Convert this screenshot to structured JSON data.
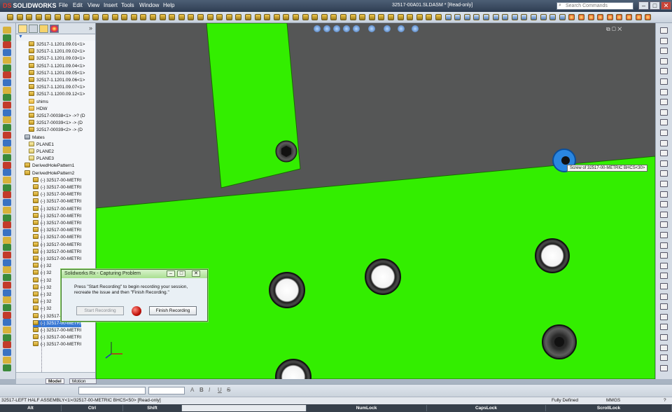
{
  "app": {
    "logo": "SOLIDWORKS",
    "document_title": "32517-00A01.SLDASM * [Read-only]",
    "menu": [
      "File",
      "Edit",
      "View",
      "Insert",
      "Tools",
      "Window",
      "Help"
    ],
    "search_placeholder": "Search Commands",
    "window_buttons": [
      "–",
      "□",
      "✕"
    ]
  },
  "tree": {
    "rows": [
      {
        "label": "32517-1.1201.09.01<1>",
        "icon": "part",
        "indent": 2
      },
      {
        "label": "32517-1.1201.09.02<1>",
        "icon": "part",
        "indent": 2
      },
      {
        "label": "32517-1.1201.09.03<1>",
        "icon": "part",
        "indent": 2
      },
      {
        "label": "32517-1.1201.09.04<1>",
        "icon": "part",
        "indent": 2
      },
      {
        "label": "32517-1.1201.09.05<1>",
        "icon": "part",
        "indent": 2
      },
      {
        "label": "32517-1.1201.09.06<1>",
        "icon": "part",
        "indent": 2
      },
      {
        "label": "32517-1.1201.09.07<1>",
        "icon": "part",
        "indent": 2
      },
      {
        "label": "32517-1.1200.09.12<1>",
        "icon": "part",
        "indent": 2
      },
      {
        "label": "shims",
        "icon": "folder",
        "indent": 2
      },
      {
        "label": "HDW",
        "icon": "folder",
        "indent": 2
      },
      {
        "label": "32517-00038<1> ->? (D",
        "icon": "part",
        "indent": 2
      },
      {
        "label": "32517-00039<1> -> (D",
        "icon": "part",
        "indent": 2
      },
      {
        "label": "32517-00039<2> -> (D",
        "icon": "part",
        "indent": 2
      },
      {
        "label": "Mates",
        "icon": "mate",
        "indent": 1
      },
      {
        "label": "PLANE1",
        "icon": "plane",
        "indent": 2
      },
      {
        "label": "PLANE2",
        "icon": "plane",
        "indent": 2
      },
      {
        "label": "PLANE3",
        "icon": "plane",
        "indent": 2
      },
      {
        "label": "DerivedHolePattern1",
        "icon": "part",
        "indent": 1
      },
      {
        "label": "DerivedHolePattern2",
        "icon": "part",
        "indent": 1
      },
      {
        "label": "(-) 32517-00-METRI",
        "icon": "part",
        "indent": 3
      },
      {
        "label": "(-) 32517-00-METRI",
        "icon": "part",
        "indent": 3
      },
      {
        "label": "(-) 32517-00-METRI",
        "icon": "part",
        "indent": 3
      },
      {
        "label": "(-) 32517-00-METRI",
        "icon": "part",
        "indent": 3
      },
      {
        "label": "(-) 32517-00-METRI",
        "icon": "part",
        "indent": 3
      },
      {
        "label": "(-) 32517-00-METRI",
        "icon": "part",
        "indent": 3
      },
      {
        "label": "(-) 32517-00-METRI",
        "icon": "part",
        "indent": 3
      },
      {
        "label": "(-) 32517-00-METRI",
        "icon": "part",
        "indent": 3
      },
      {
        "label": "(-) 32517-00-METRI",
        "icon": "part",
        "indent": 3
      },
      {
        "label": "(-) 32517-00-METRI",
        "icon": "part",
        "indent": 3
      },
      {
        "label": "(-) 32517-00-METRI",
        "icon": "part",
        "indent": 3
      },
      {
        "label": "(-) 32517-00-METRI",
        "icon": "part",
        "indent": 3
      },
      {
        "label": "(-) 32",
        "icon": "part",
        "indent": 3
      },
      {
        "label": "(-) 32",
        "icon": "part",
        "indent": 3
      },
      {
        "label": "(-) 32",
        "icon": "part",
        "indent": 3
      },
      {
        "label": "(-) 32",
        "icon": "part",
        "indent": 3
      },
      {
        "label": "(-) 32",
        "icon": "part",
        "indent": 3
      },
      {
        "label": "(-) 32",
        "icon": "part",
        "indent": 3
      },
      {
        "label": "(-) 32",
        "icon": "part",
        "indent": 3
      },
      {
        "label": "(-) 32517-00-METRI",
        "icon": "part",
        "indent": 3
      },
      {
        "label": "(-) 32517-00-METRI",
        "icon": "part",
        "indent": 3,
        "selected": true
      },
      {
        "label": "(-) 32517-00-METRI",
        "icon": "part",
        "indent": 3
      },
      {
        "label": "(-) 32517-00-METRI",
        "icon": "part",
        "indent": 3
      },
      {
        "label": "(-) 32517-00-METRI",
        "icon": "part",
        "indent": 3
      }
    ]
  },
  "bottom_tabs": [
    "Model",
    "Motion Study 1"
  ],
  "viewport": {
    "tooltip": "Screw of 32517-00-METRIC BHCS<30>",
    "part_color": "#33ee00",
    "background_color": "#555656"
  },
  "dialog": {
    "title": "Solidworks Rx - Capturing Problem",
    "message": "Press \"Start Recording\" to begin recording your session, recreate the issue and then \"Finish Recording.\"",
    "start_button": "Start Recording",
    "finish_button": "Finish Recording"
  },
  "format_bar": {
    "glyphs": [
      "A",
      "B",
      "I",
      "U",
      "S"
    ]
  },
  "status": {
    "left": "32517-LEFT HALF ASSEMBLY<1>/32517-00-METRIC BHCS<50> [Read-only]",
    "definition": "Fully Defined",
    "units": "MMGS",
    "help": "?"
  },
  "keys": [
    "Alt",
    "Ctrl",
    "Shift",
    "",
    "NumLock",
    "CapsLock",
    "ScrollLock"
  ]
}
